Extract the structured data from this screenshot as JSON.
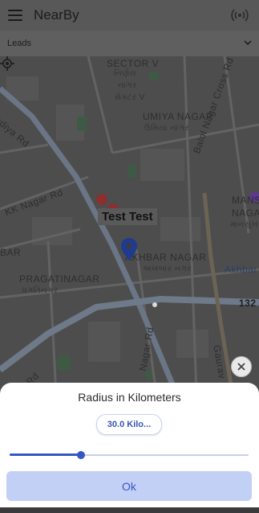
{
  "app": {
    "title": "NearBy"
  },
  "filter": {
    "selected": "Leads"
  },
  "map": {
    "marker_label": "Test Test",
    "labels": {
      "sector_v": "SECTOR V",
      "sector_v_gu": "નિર્ણય",
      "sector_v_gu2": "નાગર",
      "sector_v_hi": "સેક્ટર V",
      "umiya_nagar": "UMIYA NAGAR",
      "umiya_nagar_gu": "ઉમિયા નાગર",
      "balol_nagar": "Balol Nagar Cross Rd",
      "kk_nagar": "KK Nagar Rd",
      "odiya_rd": "odiya Rd",
      "mansu": "MANSU",
      "naga": "NAGA",
      "mansu_gu": "માનસુખ",
      "akhbar_nagar": "AKHBAR NAGAR",
      "akhbar_nagar_gu": "અખબાર નગર",
      "akhbar_right": "Akhbar",
      "bar_left": "BAR",
      "pragatinagar": "PRAGATINAGAR",
      "pragatinagar_gu": "પ્રગતિનગર",
      "nagar_rd": "Nagar Rd",
      "gaurav": "Gaurav",
      "num_132": "132",
      "rd_bottom": "Rd"
    }
  },
  "sheet": {
    "title": "Radius in Kilometers",
    "radius_value": "30.0 Kilo...",
    "slider_fraction": 0.3,
    "ok_label": "Ok"
  },
  "colors": {
    "accent": "#3557c5",
    "button_bg": "#c3d0f5",
    "marker": "#1f3b8f"
  }
}
